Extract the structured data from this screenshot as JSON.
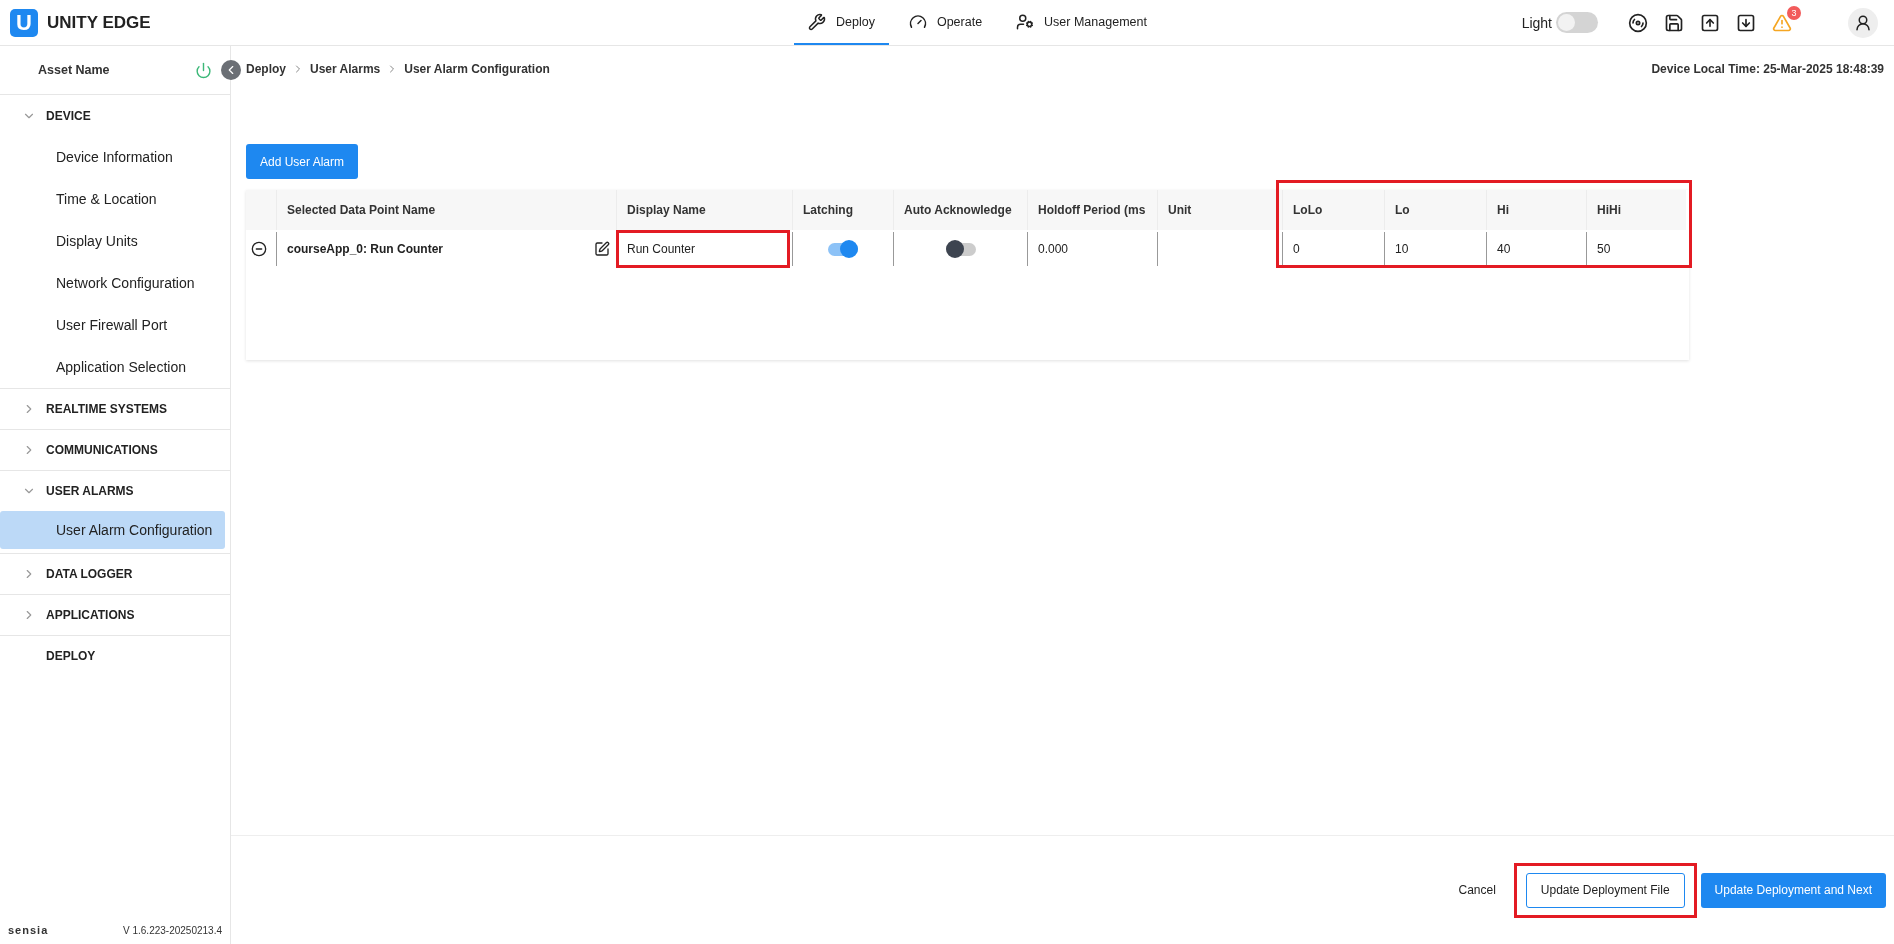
{
  "app": {
    "logo_letter": "U",
    "title": "UNITY EDGE"
  },
  "nav_tabs": [
    {
      "label": "Deploy",
      "selected": true,
      "kind": "deploy"
    },
    {
      "label": "Operate",
      "selected": false,
      "kind": "operate"
    },
    {
      "label": "User Management",
      "selected": false,
      "kind": "users"
    }
  ],
  "theme_toggle": {
    "label": "Light",
    "on": false
  },
  "alarm_badge": "3",
  "sidebar": {
    "asset_name": "Asset Name",
    "sections": [
      {
        "label": "DEVICE",
        "kind": "group",
        "expanded": true,
        "children": [
          {
            "label": "Device Information",
            "selected": false
          },
          {
            "label": "Time & Location",
            "selected": false
          },
          {
            "label": "Display Units",
            "selected": false
          },
          {
            "label": "Network Configuration",
            "selected": false
          },
          {
            "label": "User Firewall Port",
            "selected": false
          },
          {
            "label": "Application Selection",
            "selected": false
          }
        ]
      },
      {
        "label": "REALTIME SYSTEMS",
        "kind": "group",
        "expanded": false
      },
      {
        "label": "COMMUNICATIONS",
        "kind": "group",
        "expanded": false
      },
      {
        "label": "USER ALARMS",
        "kind": "group",
        "expanded": true,
        "children": [
          {
            "label": "User Alarm Configuration",
            "selected": true
          }
        ]
      },
      {
        "label": "DATA LOGGER",
        "kind": "group",
        "expanded": false
      },
      {
        "label": "APPLICATIONS",
        "kind": "group",
        "expanded": false
      },
      {
        "label": "DEPLOY",
        "kind": "link"
      }
    ],
    "brand": "sensia",
    "version": "V 1.6.223-20250213.4"
  },
  "breadcrumb": [
    "Deploy",
    "User Alarms",
    "User Alarm Configuration"
  ],
  "device_time": "Device Local Time: 25-Mar-2025 18:48:39",
  "add_button": "Add User Alarm",
  "table": {
    "columns": [
      "Selected Data Point Name",
      "Display Name",
      "Latching",
      "Auto Acknowledge",
      "Holdoff Period (ms",
      "Unit",
      "LoLo",
      "Lo",
      "Hi",
      "HiHi"
    ],
    "thresholds_highlighted": true,
    "rows": [
      {
        "data_point": "courseApp_0: Run Counter",
        "display_name": "Run Counter",
        "display_name_highlighted": true,
        "latching": true,
        "auto_acknowledge": false,
        "holdoff_period": "0.000",
        "thresholds": [
          "0",
          "10",
          "40",
          "50"
        ]
      }
    ]
  },
  "footer_buttons": [
    {
      "label": "Cancel",
      "kind": "text",
      "highlighted": false
    },
    {
      "label": "Update Deployment File",
      "kind": "outline",
      "highlighted": true
    },
    {
      "label": "Update Deployment and Next",
      "kind": "primary",
      "highlighted": false
    }
  ]
}
